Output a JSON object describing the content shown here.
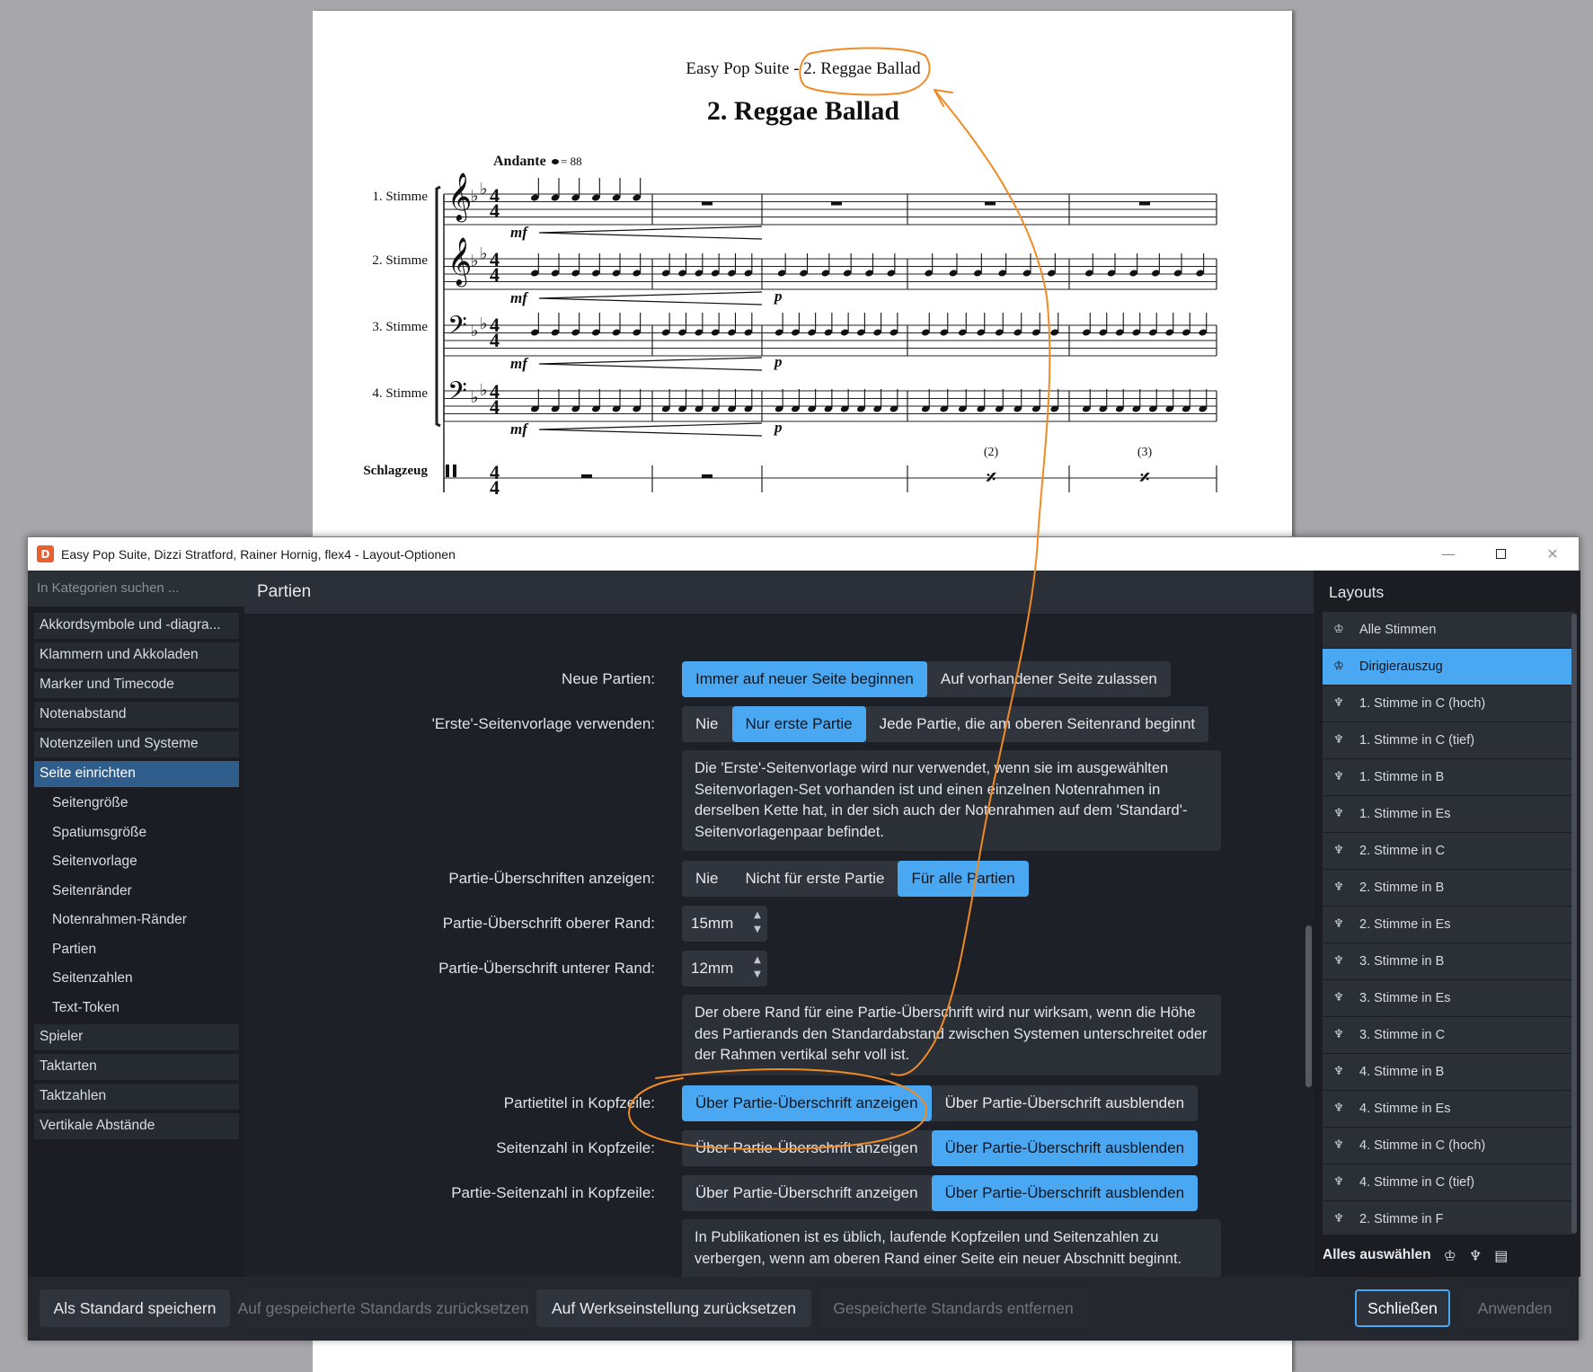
{
  "score": {
    "header": "Easy Pop Suite - 2. Reggae Ballad",
    "title": "2. Reggae Ballad",
    "tempo": "Andante",
    "tempo_value": "= 88",
    "staves": [
      "1. Stimme",
      "2. Stimme",
      "3. Stimme",
      "4. Stimme",
      "Schlagzeug"
    ],
    "dynamics": {
      "mf": "mf",
      "p": "p"
    },
    "repeat_counts": [
      "(2)",
      "(3)"
    ]
  },
  "dialog": {
    "window_title": "Easy Pop Suite, Dizzi Stratford, Rainer Hornig, flex4 - Layout-Optionen",
    "minimize": "—",
    "close": "✕",
    "search_placeholder": "In Kategorien suchen ...",
    "categories": [
      {
        "label": "Akkordsymbole und -diagra..."
      },
      {
        "label": "Klammern und Akkoladen"
      },
      {
        "label": "Marker und Timecode"
      },
      {
        "label": "Notenabstand"
      },
      {
        "label": "Notenzeilen und Systeme"
      },
      {
        "label": "Seite einrichten"
      },
      {
        "label": "Seitengröße"
      },
      {
        "label": "Spatiumsgröße"
      },
      {
        "label": "Seitenvorlage"
      },
      {
        "label": "Seitenränder"
      },
      {
        "label": "Notenrahmen-Ränder"
      },
      {
        "label": "Partien"
      },
      {
        "label": "Seitenzahlen"
      },
      {
        "label": "Text-Token"
      },
      {
        "label": "Spieler"
      },
      {
        "label": "Taktarten"
      },
      {
        "label": "Taktzahlen"
      },
      {
        "label": "Vertikale Abstände"
      }
    ],
    "section_title": "Partien",
    "options": {
      "neue_partien": {
        "label": "Neue Partien:",
        "choices": [
          "Immer auf neuer Seite beginnen",
          "Auf vorhandener Seite zulassen"
        ],
        "selected": 0
      },
      "erste_vorlage": {
        "label": "'Erste'-Seitenvorlage verwenden:",
        "choices": [
          "Nie",
          "Nur erste Partie",
          "Jede Partie, die am oberen Seitenrand beginnt"
        ],
        "selected": 1
      },
      "info1": "Die 'Erste'-Seitenvorlage wird nur verwendet, wenn sie im ausgewählten Seitenvorlagen-Set vorhanden ist und einen einzelnen Notenrahmen in derselben Kette hat, in der sich auch der Notenrahmen auf dem 'Standard'-Seitenvorlagenpaar befindet.",
      "ueberschriften": {
        "label": "Partie-Überschriften anzeigen:",
        "choices": [
          "Nie",
          "Nicht für erste Partie",
          "Für alle Partien"
        ],
        "selected": 2
      },
      "oberer_rand": {
        "label": "Partie-Überschrift oberer Rand:",
        "value": "15mm"
      },
      "unterer_rand": {
        "label": "Partie-Überschrift unterer Rand:",
        "value": "12mm"
      },
      "info2": "Der obere Rand für eine Partie-Überschrift wird nur wirksam, wenn die Höhe des Partierands den Standardabstand zwischen Systemen unterschreitet oder der Rahmen vertikal sehr voll ist.",
      "partietitel": {
        "label": "Partietitel in Kopfzeile:",
        "choices": [
          "Über Partie-Überschrift anzeigen",
          "Über Partie-Überschrift ausblenden"
        ],
        "selected": 0
      },
      "seitenzahl": {
        "label": "Seitenzahl in Kopfzeile:",
        "choices": [
          "Über Partie-Überschrift anzeigen",
          "Über Partie-Überschrift ausblenden"
        ],
        "selected": 1
      },
      "partie_seitenzahl": {
        "label": "Partie-Seitenzahl in Kopfzeile:",
        "choices": [
          "Über Partie-Überschrift anzeigen",
          "Über Partie-Überschrift ausblenden"
        ],
        "selected": 1
      },
      "info3": "In Publikationen ist es üblich, laufende Kopfzeilen und Seitenzahlen zu verbergen, wenn am oberen Rand einer Seite ein neuer Abschnitt beginnt."
    },
    "layouts_title": "Layouts",
    "layouts": [
      {
        "label": "Alle Stimmen",
        "icon": "full-score-icon"
      },
      {
        "label": "Dirigierauszug",
        "icon": "full-score-icon"
      },
      {
        "label": "1. Stimme in C (hoch)",
        "icon": "part-icon"
      },
      {
        "label": "1. Stimme in C (tief)",
        "icon": "part-icon"
      },
      {
        "label": "1. Stimme in B",
        "icon": "part-icon"
      },
      {
        "label": "1. Stimme in Es",
        "icon": "part-icon"
      },
      {
        "label": "2. Stimme in C",
        "icon": "part-icon"
      },
      {
        "label": "2. Stimme in B",
        "icon": "part-icon"
      },
      {
        "label": "2. Stimme in Es",
        "icon": "part-icon"
      },
      {
        "label": "3. Stimme in B",
        "icon": "part-icon"
      },
      {
        "label": "3. Stimme in Es",
        "icon": "part-icon"
      },
      {
        "label": "3. Stimme in C",
        "icon": "part-icon"
      },
      {
        "label": "4. Stimme in B",
        "icon": "part-icon"
      },
      {
        "label": "4. Stimme in Es",
        "icon": "part-icon"
      },
      {
        "label": "4. Stimme in C (hoch)",
        "icon": "part-icon"
      },
      {
        "label": "4. Stimme in C (tief)",
        "icon": "part-icon"
      },
      {
        "label": "2. Stimme in F",
        "icon": "part-icon"
      }
    ],
    "select_all": "Alles auswählen",
    "buttons": {
      "save_default": "Als Standard speichern",
      "reset_saved": "Auf gespeicherte Standards zurücksetzen",
      "reset_factory": "Auf Werkseinstellung zurücksetzen",
      "remove_saved": "Gespeicherte Standards entfernen",
      "close": "Schließen",
      "apply": "Anwenden"
    }
  },
  "colors": {
    "accent": "#4aa7f2",
    "annotation": "#f08a24",
    "selected_category": "#2f5d8c"
  }
}
